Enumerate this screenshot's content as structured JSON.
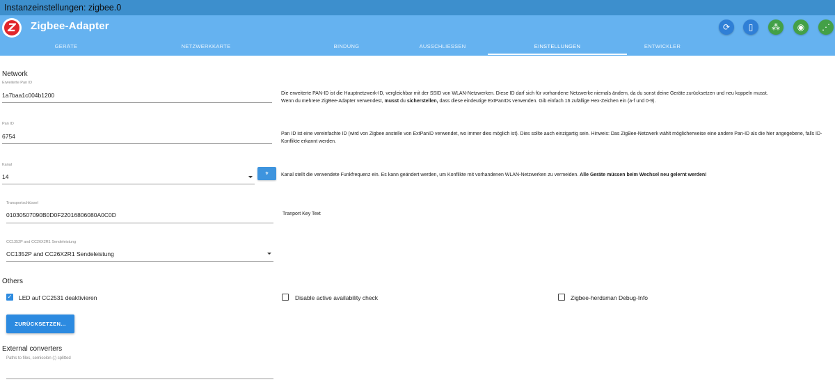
{
  "window": {
    "title": "Instanzeinstellungen: zigbee.0"
  },
  "header": {
    "app_title": "Zigbee-Adapter",
    "logo_letter": "Z",
    "buttons": [
      {
        "icon": "refresh-icon",
        "glyph": "⟳"
      },
      {
        "icon": "device-icon",
        "glyph": "▯"
      },
      {
        "icon": "group-icon",
        "glyph": "⁂"
      },
      {
        "icon": "signal-icon",
        "glyph": "◉"
      },
      {
        "icon": "network-icon",
        "glyph": "⋰"
      }
    ]
  },
  "tabs": [
    {
      "label": "GERÄTE"
    },
    {
      "label": "NETZWERKKARTE"
    },
    {
      "label": "BINDUNG"
    },
    {
      "label": "AUSSCHLIESSEN"
    },
    {
      "label": "EINSTELLUNGEN",
      "active": true
    },
    {
      "label": "ENTWICKLER"
    }
  ],
  "network": {
    "title": "Network",
    "ext_pan_id": {
      "label": "Erweiterte Pan ID",
      "value": "1a7baa1c004b1200",
      "help_1": "Die erweiterte PAN-ID ist die Hauptnetzwerk-ID, vergleichbar mit der SSID von WLAN-Netzwerken. Diese ID darf sich für vorhandene Netzwerke niemals ändern, da du sonst deine Geräte zurücksetzen und neu koppeln musst.",
      "help_2a": "Wenn du mehrere ZigBee-Adapter verwendest, ",
      "help_2b": "musst",
      "help_2c": " du ",
      "help_2d": "sicherstellen,",
      "help_2e": " dass diese eindeutige ExtPanIDs verwenden. Gib einfach 16 zufällige Hex-Zeichen ein (a-f und 0-9)."
    },
    "pan_id": {
      "label": "Pan ID",
      "value": "6754",
      "help": "Pan ID ist eine vereinfachte ID (wird von Zigbee anstelle von ExtPanID verwendet, wo immer dies möglich ist). Dies sollte auch einzigartig sein. Hinweis: Das ZigBee-Netzwerk wählt möglicherweise eine andere Pan-ID als die hier angegebene, falls ID-Konflikte erkannt werden."
    },
    "channel": {
      "label": "Kanal",
      "value": "14",
      "help_a": "Kanal stellt die verwendete Funkfrequenz ein. Es kann geändert werden, um Konflikte mit vorhandenen WLAN-Netzwerken zu vermeiden. ",
      "help_b": "Alle Geräte müssen beim Wechsel neu gelernt werden!"
    },
    "transport_key": {
      "label": "Transportschlüssel",
      "value": "01030507090B0D0F22016806080A0C0D",
      "help": "Tranport Key Text"
    },
    "tx_power": {
      "label": "CC1352P and CC26X2R1 Sendeleistung",
      "value": "CC1352P and CC26X2R1 Sendeleistung"
    }
  },
  "others": {
    "title": "Others",
    "led_disable": {
      "label": "LED auf CC2531 deaktivieren",
      "checked": true
    },
    "availability": {
      "label": "Disable active availability check",
      "checked": false
    },
    "debug": {
      "label": "Zigbee-herdsman Debug-Info",
      "checked": false
    },
    "reset_label": "ZURÜCKSETZEN..."
  },
  "converters": {
    "title": "External converters",
    "label": "Paths to files, semicolon (;) splitted",
    "value": ""
  }
}
